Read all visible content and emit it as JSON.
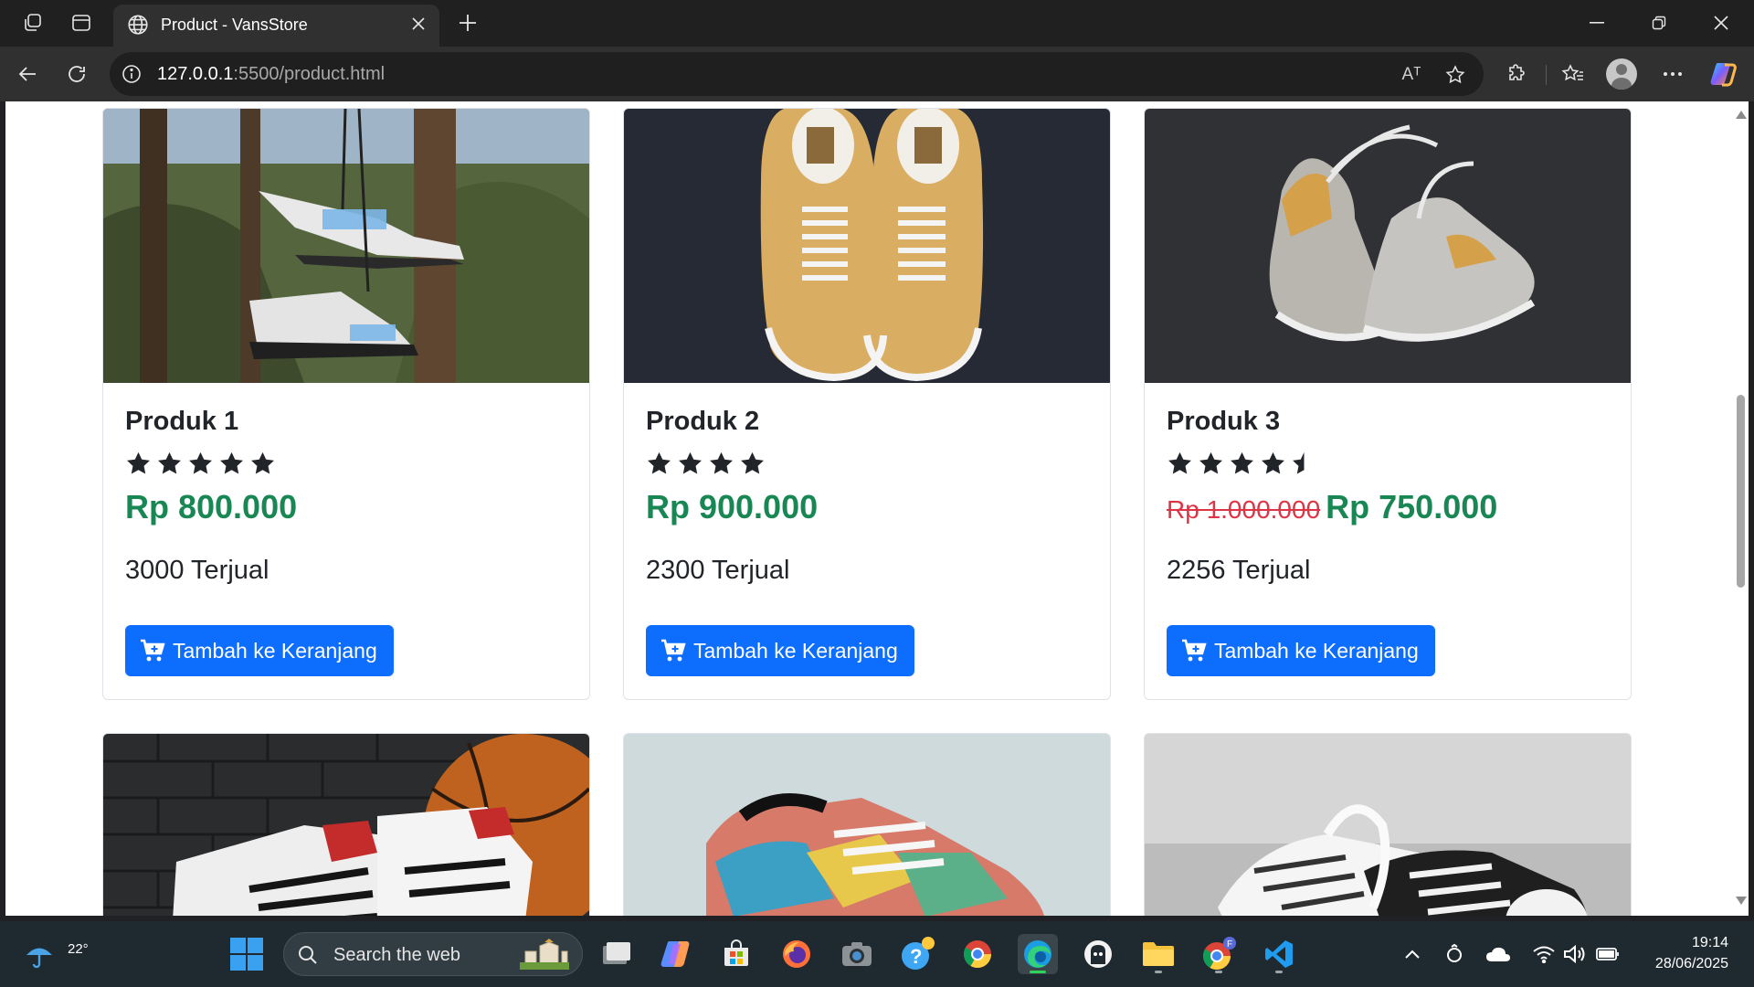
{
  "browser": {
    "tab_title": "Product - VansStore",
    "url_host": "127.0.0.1",
    "url_rest": ":5500/product.html",
    "read_aloud_label": "Aᵀ"
  },
  "products": [
    {
      "name": "Produk 1",
      "rating": 5,
      "old_price": "",
      "price": "Rp 800.000",
      "sold": "3000 Terjual",
      "button": "Tambah ke Keranjang",
      "image": "white-knit-sneakers-hanging-on-tree"
    },
    {
      "name": "Produk 2",
      "rating": 4,
      "old_price": "",
      "price": "Rp 900.000",
      "sold": "2300 Terjual",
      "button": "Tambah ke Keranjang",
      "image": "tan-vans-authentic-on-dark-background"
    },
    {
      "name": "Produk 3",
      "rating": 4.5,
      "old_price": "Rp 1.000.000",
      "price": "Rp 750.000",
      "sold": "2256 Terjual",
      "button": "Tambah ke Keranjang",
      "image": "grey-high-top-sneakers-on-dark-background"
    },
    {
      "image": "white-red-basketball-sneakers-with-ball"
    },
    {
      "image": "colorful-snakeskin-sneakers"
    },
    {
      "image": "black-white-canvas-sneakers"
    }
  ],
  "taskbar": {
    "weather_temp": "22°",
    "search_placeholder": "Search the web",
    "time": "19:14",
    "date": "28/06/2025"
  },
  "colors": {
    "price_green": "#198754",
    "strike_red": "#dc3545",
    "button_blue": "#0d6efd",
    "star": "#212529"
  }
}
